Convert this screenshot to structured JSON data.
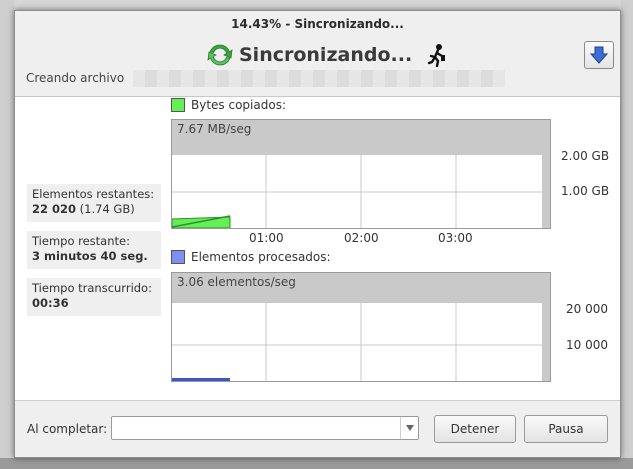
{
  "window": {
    "title": "14.43% - Sincronizando..."
  },
  "header": {
    "status_text": "Sincronizando...",
    "creating_label": "Creando archivo"
  },
  "stats": {
    "items_remaining_label": "Elementos restantes:",
    "items_remaining_value": "22 020",
    "items_remaining_size": "(1.74 GB)",
    "time_remaining_label": "Tiempo restante:",
    "time_remaining_value": "3 minutos 40 seg.",
    "time_elapsed_label": "Tiempo transcurrido:",
    "time_elapsed_value": "00:36"
  },
  "graphs": {
    "bytes": {
      "legend": "Bytes copiados:",
      "rate": "7.67 MB/seg",
      "color": "#66ee55",
      "y_ticks": [
        "2.00 GB",
        "1.00 GB"
      ],
      "x_ticks": [
        "01:00",
        "02:00",
        "03:00"
      ]
    },
    "items": {
      "legend": "Elementos procesados:",
      "rate": "3.06 elementos/seg",
      "color": "#7f8ff0",
      "y_ticks": [
        "20 000",
        "10 000"
      ]
    }
  },
  "chart_data": [
    {
      "type": "area",
      "series": [
        {
          "name": "Bytes copiados",
          "x": [
            "00:00",
            "00:36"
          ],
          "y": [
            0,
            0.25
          ]
        }
      ],
      "x_ticks": [
        "01:00",
        "02:00",
        "03:00"
      ],
      "y_ticks": [
        "1.00 GB",
        "2.00 GB"
      ],
      "ylim": [
        0,
        2.5
      ],
      "grid": true
    },
    {
      "type": "area",
      "series": [
        {
          "name": "Elementos procesados",
          "x": [
            "00:00",
            "00:36"
          ],
          "y": [
            0,
            0
          ]
        }
      ],
      "y_ticks": [
        "10 000",
        "20 000"
      ],
      "grid": true
    }
  ],
  "footer": {
    "on_completion_label": "Al completar:",
    "combo_value": "",
    "stop_label": "Detener",
    "pause_label": "Pausa"
  },
  "colors": {
    "accent_sync": "#3aa63a",
    "arrow_blue": "#3a6fd8"
  },
  "icons": {
    "sync": "sync-icon",
    "walker": "walker-icon",
    "down": "arrow-down-icon"
  }
}
